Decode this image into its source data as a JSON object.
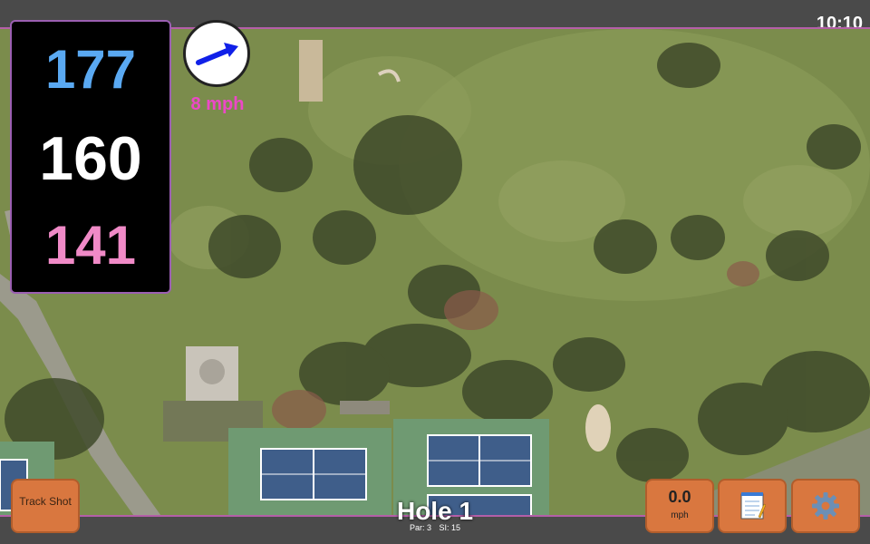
{
  "clock": "10:10",
  "distances": {
    "back": "177",
    "middle": "160",
    "front": "141"
  },
  "wind": {
    "speed": "8 mph",
    "icon": "wind-direction-arrow-icon"
  },
  "hole": {
    "title": "Hole 1",
    "par": "Par: 3",
    "si": "SI: 15"
  },
  "buttons": {
    "track_shot": "Track Shot",
    "speed_value": "0.0",
    "speed_unit": "mph",
    "notes_icon": "notepad-icon",
    "settings_icon": "gear-icon"
  },
  "colors": {
    "back_distance": "#5aa9f2",
    "middle_distance": "#ffffff",
    "front_distance": "#f08ac7",
    "wind_speed": "#ec48c7",
    "button": "#d9773f",
    "accent_border": "#9b5fb2"
  }
}
